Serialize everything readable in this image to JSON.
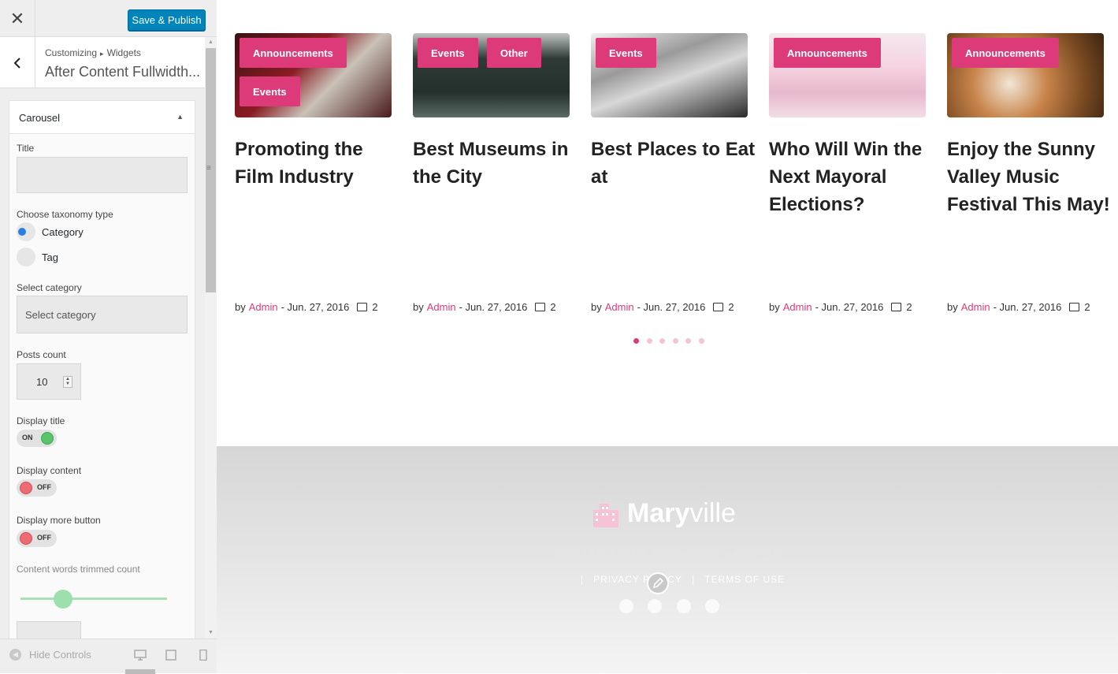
{
  "topbar": {
    "close_glyph": "✕",
    "publish_label": "Save & Publish"
  },
  "section": {
    "breadcrumb_root": "Customizing",
    "breadcrumb_sep": "▸",
    "breadcrumb_leaf": "Widgets",
    "title": "After Content Fullwidth..."
  },
  "widget": {
    "name": "Carousel",
    "toggle_glyph": "▲",
    "title_label": "Title",
    "title_value": "",
    "taxonomy_label": "Choose taxonomy type",
    "taxonomy_options": [
      "Category",
      "Tag"
    ],
    "taxonomy_selected": "Category",
    "category_label": "Select category",
    "category_value": "Select category",
    "posts_count_label": "Posts count",
    "posts_count_value": "10",
    "display_title_label": "Display title",
    "display_title_state": "ON",
    "display_content_label": "Display content",
    "display_content_state": "OFF",
    "display_more_label": "Display more button",
    "display_more_state": "OFF",
    "trim_label": "Content words trimmed count"
  },
  "footer_controls": {
    "hide_label": "Hide Controls",
    "devices": [
      "desktop-icon",
      "tablet-icon",
      "mobile-icon"
    ]
  },
  "posts": [
    {
      "tags": [
        "Announcements",
        "Events"
      ],
      "title": "Promoting the Film Industry",
      "by": "by",
      "author": "Admin",
      "date": "- Jun. 27, 2016",
      "comments": "2"
    },
    {
      "tags": [
        "Events",
        "Other"
      ],
      "title": "Best Museums in the City",
      "by": "by",
      "author": "Admin",
      "date": "- Jun. 27, 2016",
      "comments": "2"
    },
    {
      "tags": [
        "Events"
      ],
      "title": "Best Places to Eat at",
      "by": "by",
      "author": "Admin",
      "date": "- Jun. 27, 2016",
      "comments": "2"
    },
    {
      "tags": [
        "Announcements"
      ],
      "title": "Who Will Win the Next Mayoral Elections?",
      "by": "by",
      "author": "Admin",
      "date": "- Jun. 27, 2016",
      "comments": "2"
    },
    {
      "tags": [
        "Announcements"
      ],
      "title": "Enjoy the Sunny Valley Music Festival This May!",
      "by": "by",
      "author": "Admin",
      "date": "- Jun. 27, 2016",
      "comments": "2"
    }
  ],
  "carousel": {
    "pages": 6,
    "active_page": 1
  },
  "site_footer": {
    "logo_bold": "Mary",
    "logo_light": "ville",
    "copyright": "© 2017 ALL RIGHTS RESERVED BY MARYVILLE",
    "links": [
      "PRIVACY POLICY",
      "TERMS OF USE"
    ],
    "link_sep": "|",
    "socials": [
      "facebook-icon",
      "twitter-icon",
      "google-plus-icon",
      "instagram-icon"
    ]
  },
  "colors": {
    "accent": "#dd3a7a",
    "publish": "#0085ba",
    "toggle_on": "#5bc46a",
    "toggle_off": "#ee6b73",
    "radio": "#2a7de1"
  }
}
